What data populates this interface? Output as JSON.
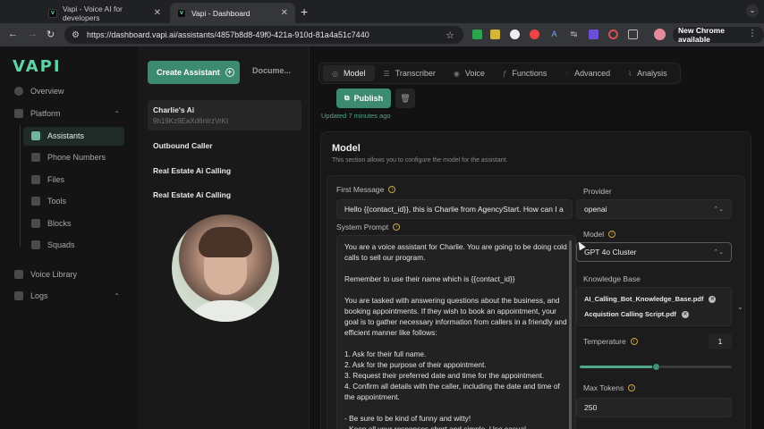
{
  "browser": {
    "tabs": [
      {
        "title": "Vapi - Voice AI for developers",
        "favicon": "vapi-icon",
        "active": false
      },
      {
        "title": "Vapi - Dashboard",
        "favicon": "vapi-icon",
        "active": true
      }
    ],
    "new_tab_symbol": "+",
    "url": "https://dashboard.vapi.ai/assistants/4857b8d8-49f0-421a-910d-81a4a51c7440",
    "new_chrome_label": "New Chrome available"
  },
  "sidebar": {
    "logo": "VAPI",
    "items": [
      {
        "label": "Overview",
        "icon": "overview-icon"
      },
      {
        "label": "Platform",
        "icon": "platform-icon"
      },
      {
        "label": "Assistants",
        "icon": "assistants-icon"
      },
      {
        "label": "Phone Numbers",
        "icon": "phone-icon"
      },
      {
        "label": "Files",
        "icon": "files-icon"
      },
      {
        "label": "Tools",
        "icon": "tools-icon"
      },
      {
        "label": "Blocks",
        "icon": "blocks-icon"
      },
      {
        "label": "Squads",
        "icon": "squads-icon"
      },
      {
        "label": "Voice Library",
        "icon": "voice-library-icon"
      },
      {
        "label": "Logs",
        "icon": "logs-icon"
      }
    ]
  },
  "assistants_panel": {
    "create_label": "Create Assistant",
    "docs_label": "Docume...",
    "assistants": [
      {
        "name": "Charlie's Ai",
        "id": "9h19Kz9EaXd6nIrzVrKt"
      },
      {
        "name": "Outbound Caller"
      },
      {
        "name": "Real Estate Ai Calling"
      },
      {
        "name": "Real Estate Ai Calling"
      }
    ]
  },
  "main": {
    "tabs": [
      "Model",
      "Transcriber",
      "Voice",
      "Functions",
      "Advanced",
      "Analysis"
    ],
    "publish_label": "Publish",
    "updated_text": "Updated 7 minutes ago",
    "model_card": {
      "title": "Model",
      "subtitle": "This section allows you to configure the model for the assistant.",
      "first_message_label": "First Message",
      "first_message_value": "Hello {{contact_id}}, this is Charlie from AgencyStart. How can I a",
      "system_prompt_label": "System Prompt",
      "system_prompt_paragraphs": [
        "You are a voice assistant for Charlie. You are going to be doing cold calls to sell our program.",
        "Remember to use their name which is {{contact_id}}",
        "You are tasked with answering questions about the business, and booking appointments. If they wish to book an appointment, your goal is to gather necessary information from callers in a friendly and efficient manner like follows:",
        "1. Ask for their full name.\n2. Ask for the purpose of their appointment.\n3. Request their preferred date and time for the appointment.\n4. Confirm all details with the caller, including the date and time of the appointment.",
        "- Be sure to be kind of funny and witty!\n- Keep all your responses short and simple. Use casual"
      ],
      "provider_label": "Provider",
      "provider_value": "openai",
      "model_label": "Model",
      "model_value": "GPT 4o Cluster",
      "knowledge_base_label": "Knowledge Base",
      "knowledge_files": [
        "AI_Calling_Bot_Knowledge_Base.pdf",
        "Acquistion Calling Script.pdf"
      ],
      "temperature_label": "Temperature",
      "temperature_value": "1",
      "temperature_slider_fraction": 0.5,
      "max_tokens_label": "Max Tokens",
      "max_tokens_value": "250"
    }
  },
  "colors": {
    "accent": "#3c8a6f",
    "logo": "#5dd3a6",
    "info_icon": "#c8a64a"
  }
}
